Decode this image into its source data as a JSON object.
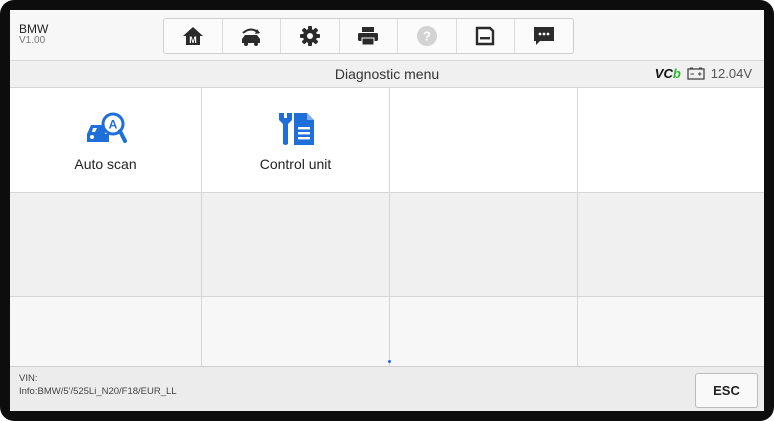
{
  "header": {
    "brand": "BMW",
    "version": "V1.00",
    "toolbar_icons": [
      "home-icon",
      "vehicle-swap-icon",
      "settings-icon",
      "print-icon",
      "help-icon",
      "save-icon",
      "message-icon"
    ]
  },
  "titlebar": {
    "title": "Diagnostic menu",
    "vci_label": "VC",
    "voltage": "12.04V"
  },
  "functions": [
    {
      "label": "Auto scan",
      "icon": "auto-scan-icon"
    },
    {
      "label": "Control unit",
      "icon": "control-unit-icon"
    }
  ],
  "footer": {
    "vin_label": "VIN:",
    "info": "Info:BMW/5'/525Li_N20/F18/EUR_LL",
    "esc_label": "ESC"
  },
  "colors": {
    "accent": "#1e6fd9",
    "vci_green": "#2eb82e"
  }
}
